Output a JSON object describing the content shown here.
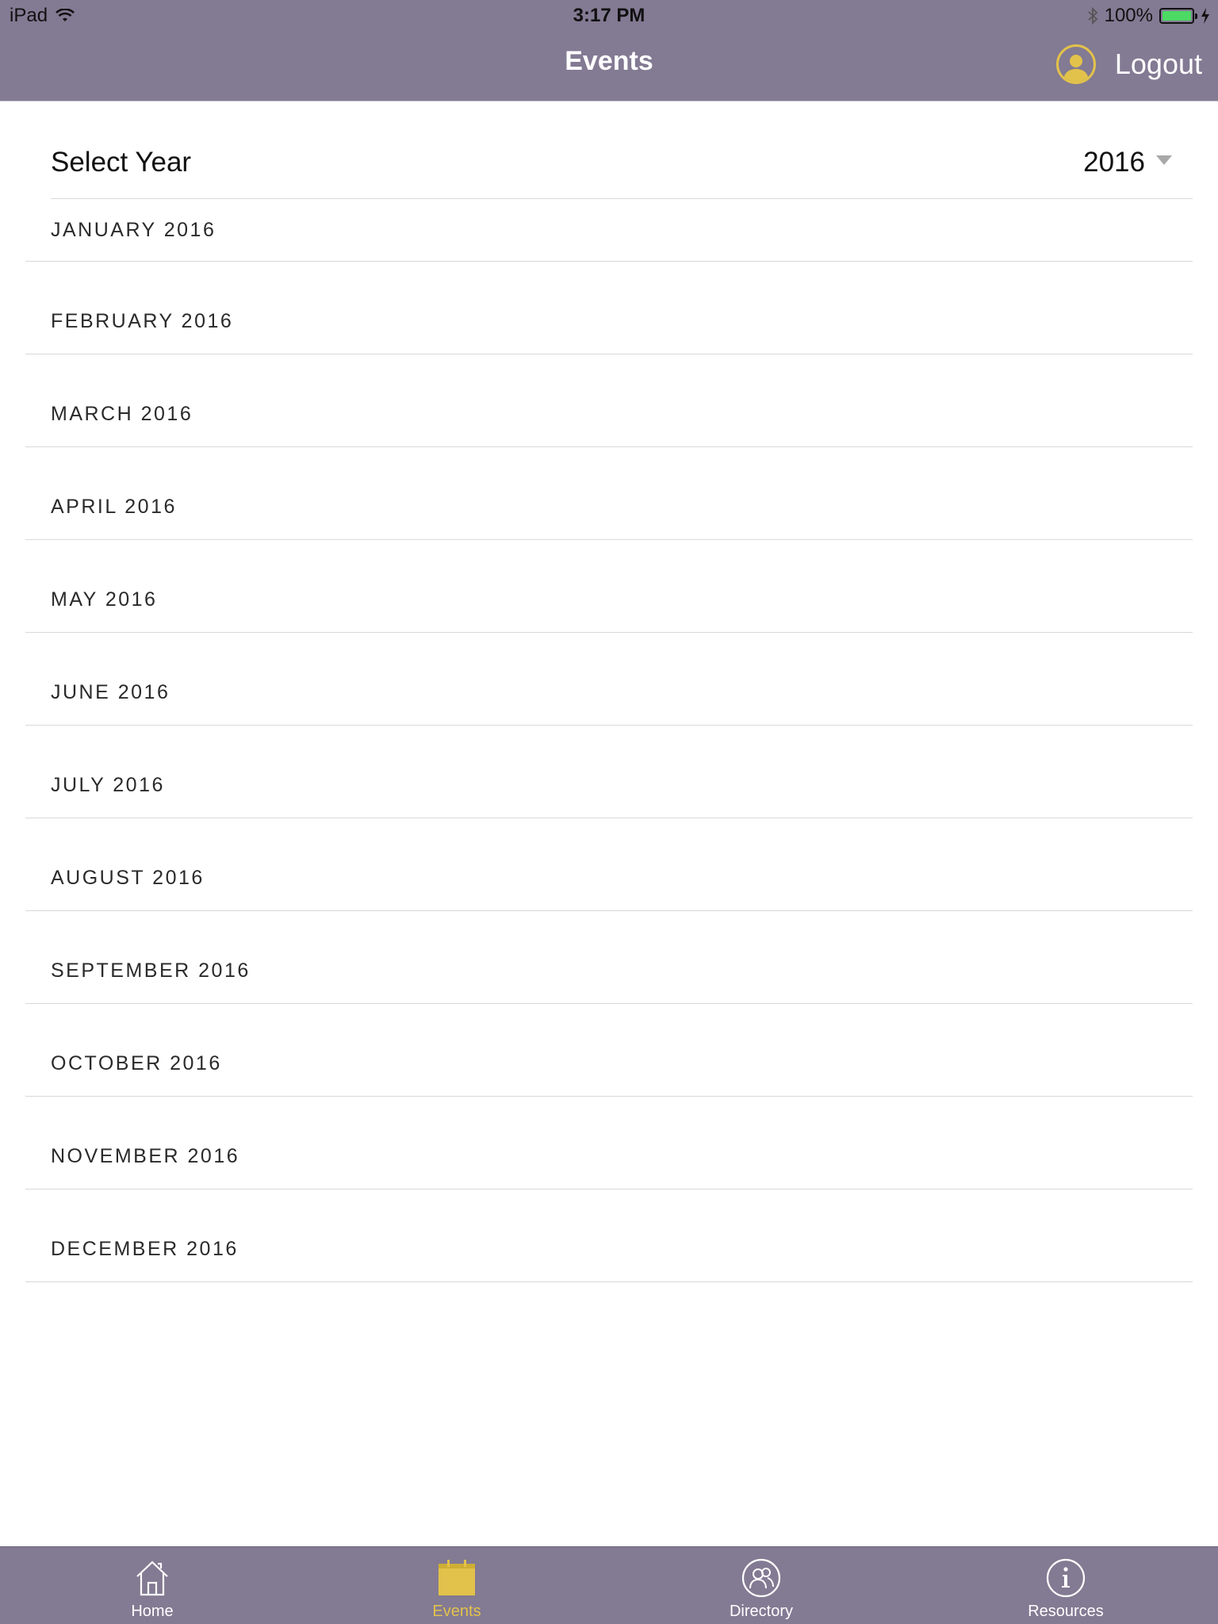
{
  "status_bar": {
    "carrier": "iPad",
    "time": "3:17 PM",
    "battery_percent": "100%",
    "battery_level": 1.0
  },
  "nav": {
    "title": "Events",
    "logout_label": "Logout"
  },
  "year_picker": {
    "label": "Select Year",
    "selected": "2016"
  },
  "months": [
    "JANUARY 2016",
    "FEBRUARY 2016",
    "MARCH 2016",
    "APRIL 2016",
    "MAY 2016",
    "JUNE 2016",
    "JULY 2016",
    "AUGUST 2016",
    "SEPTEMBER 2016",
    "OCTOBER 2016",
    "NOVEMBER 2016",
    "DECEMBER 2016"
  ],
  "tabs": [
    {
      "label": "Home",
      "icon": "home-icon",
      "active": false
    },
    {
      "label": "Events",
      "icon": "calendar-icon",
      "active": true
    },
    {
      "label": "Directory",
      "icon": "people-icon",
      "active": false
    },
    {
      "label": "Resources",
      "icon": "info-icon",
      "active": false
    }
  ],
  "colors": {
    "bar": "#837a93",
    "accent": "#e2c24a",
    "divider": "#d9d9d9"
  }
}
